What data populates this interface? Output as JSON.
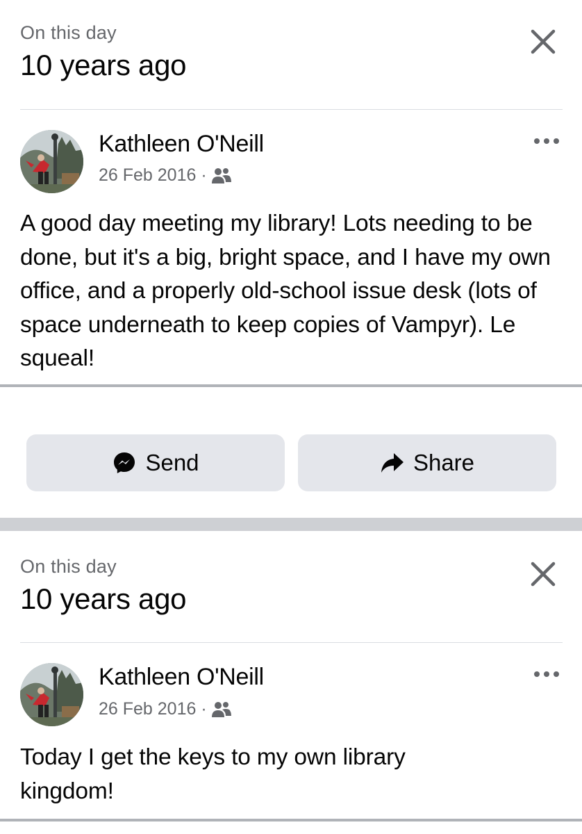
{
  "memories": [
    {
      "kicker": "On this day",
      "title": "10 years ago",
      "author": "Kathleen O'Neill",
      "date": "26 Feb 2016",
      "separator": "·",
      "audience_icon": "friends-icon",
      "post_text": "A good day meeting my library! Lots needing to be done, but it's a big, bright space, and I have my own office, and a properly old-school issue desk (lots of space underneath to keep copies of Vampyr). Le squeal!",
      "actions": {
        "send_label": "Send",
        "share_label": "Share"
      }
    },
    {
      "kicker": "On this day",
      "title": "10 years ago",
      "author": "Kathleen O'Neill",
      "date": "26 Feb 2016",
      "separator": "·",
      "audience_icon": "friends-icon",
      "post_text": "Today I get the keys to my own library kingdom!"
    }
  ],
  "icons": {
    "close": "close-icon",
    "more": "more-options-icon",
    "send": "messenger-icon",
    "share": "share-arrow-icon"
  },
  "colors": {
    "primary_text": "#050505",
    "secondary_text": "#65676b",
    "button_bg": "#e4e6eb",
    "separator_band": "#ced0d4"
  }
}
